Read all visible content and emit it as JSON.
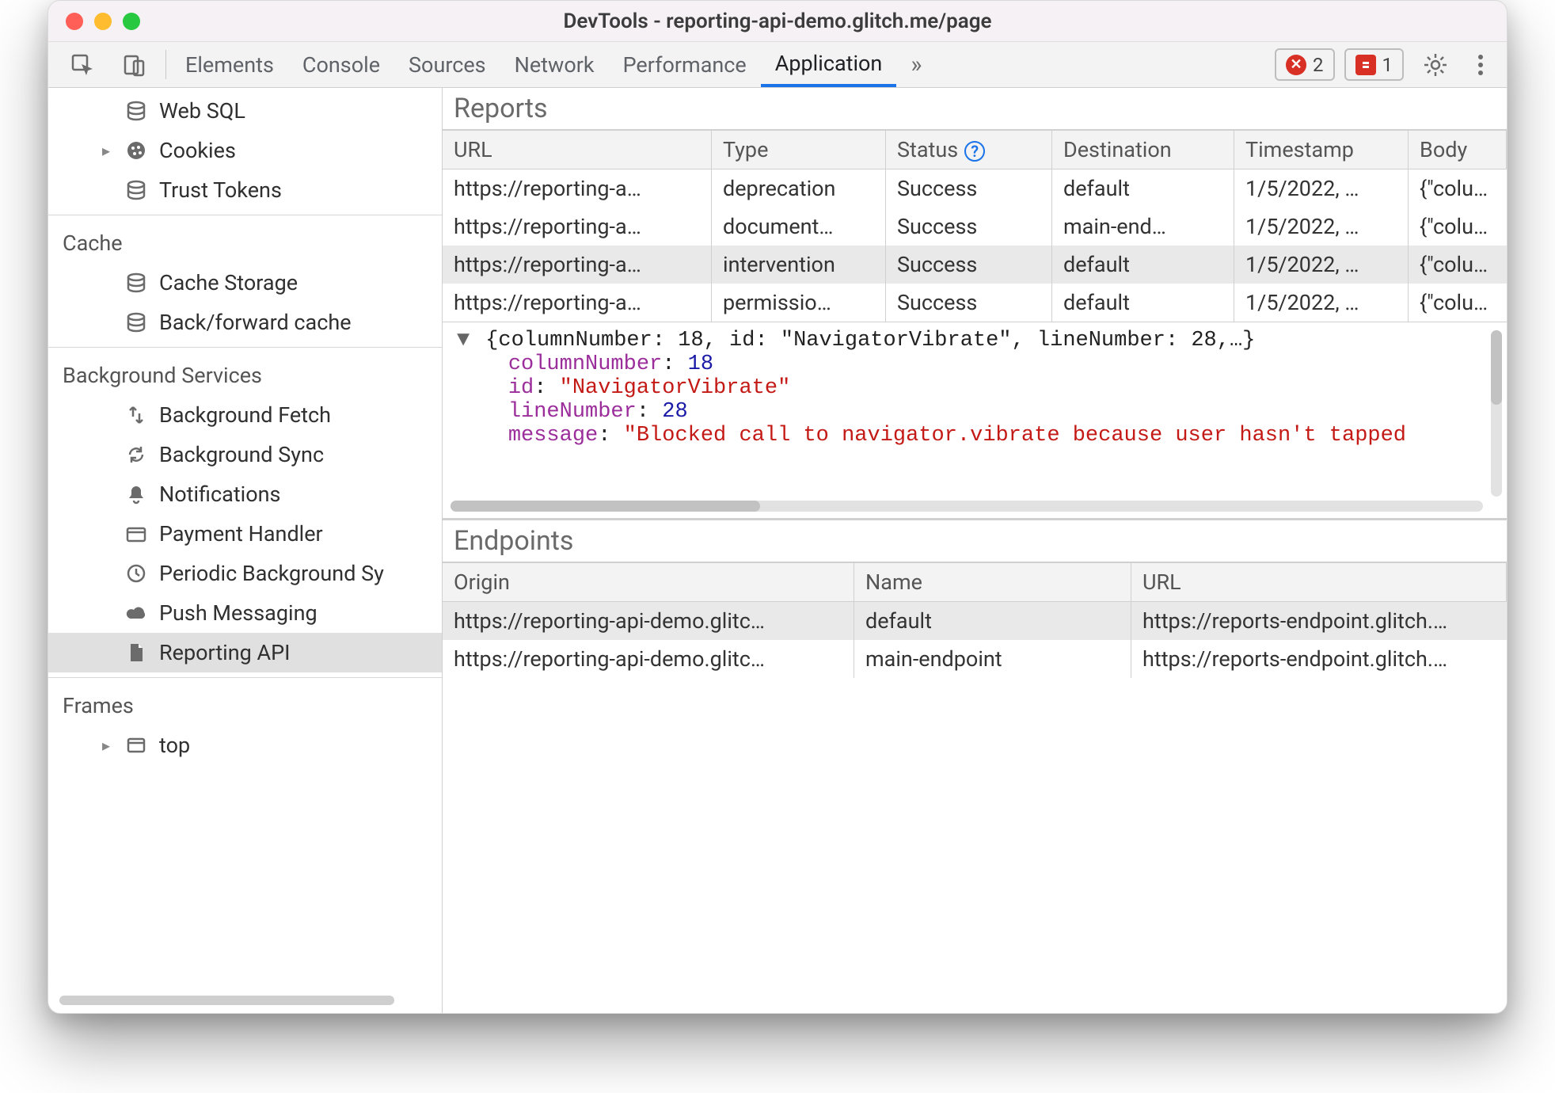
{
  "window": {
    "title": "DevTools - reporting-api-demo.glitch.me/page"
  },
  "tabrow": {
    "tabs": [
      "Elements",
      "Console",
      "Sources",
      "Network",
      "Performance",
      "Application"
    ],
    "active": "Application",
    "errors_count": "2",
    "issues_count": "1"
  },
  "sidebar": {
    "group1": [
      {
        "icon": "db",
        "label": "Web SQL"
      },
      {
        "icon": "cookie",
        "label": "Cookies",
        "caret": true
      },
      {
        "icon": "db",
        "label": "Trust Tokens"
      }
    ],
    "cache_label": "Cache",
    "cache": [
      {
        "icon": "db",
        "label": "Cache Storage"
      },
      {
        "icon": "db",
        "label": "Back/forward cache"
      }
    ],
    "bg_label": "Background Services",
    "bg": [
      {
        "icon": "bgfetch",
        "label": "Background Fetch"
      },
      {
        "icon": "sync",
        "label": "Background Sync"
      },
      {
        "icon": "bell",
        "label": "Notifications"
      },
      {
        "icon": "card",
        "label": "Payment Handler"
      },
      {
        "icon": "clock",
        "label": "Periodic Background Sy"
      },
      {
        "icon": "cloud",
        "label": "Push Messaging"
      },
      {
        "icon": "doc",
        "label": "Reporting API",
        "selected": true
      }
    ],
    "frames_label": "Frames",
    "frames": [
      {
        "icon": "frame",
        "label": "top",
        "caret": true
      }
    ]
  },
  "reports": {
    "title": "Reports",
    "headers": [
      "URL",
      "Type",
      "Status",
      "Destination",
      "Timestamp",
      "Body"
    ],
    "rows": [
      {
        "url": "https://reporting-a…",
        "type": "deprecation",
        "status": "Success",
        "dest": "default",
        "ts": "1/5/2022, …",
        "body": "{\"column…"
      },
      {
        "url": "https://reporting-a…",
        "type": "document…",
        "status": "Success",
        "dest": "main-end…",
        "ts": "1/5/2022, …",
        "body": "{\"column…"
      },
      {
        "url": "https://reporting-a…",
        "type": "intervention",
        "status": "Success",
        "dest": "default",
        "ts": "1/5/2022, …",
        "body": "{\"column…",
        "selected": true
      },
      {
        "url": "https://reporting-a…",
        "type": "permissio…",
        "status": "Success",
        "dest": "default",
        "ts": "1/5/2022, …",
        "body": "{\"column…"
      }
    ]
  },
  "preview": {
    "summary": "{columnNumber: 18, id: \"NavigatorVibrate\", lineNumber: 28,…}",
    "columnNumber_key": "columnNumber",
    "columnNumber_val": "18",
    "id_key": "id",
    "id_val": "\"NavigatorVibrate\"",
    "lineNumber_key": "lineNumber",
    "lineNumber_val": "28",
    "message_key": "message",
    "message_val": "\"Blocked call to navigator.vibrate because user hasn't tapped"
  },
  "endpoints": {
    "title": "Endpoints",
    "headers": [
      "Origin",
      "Name",
      "URL"
    ],
    "rows": [
      {
        "origin": "https://reporting-api-demo.glitc…",
        "name": "default",
        "url": "https://reports-endpoint.glitch.…",
        "selected": true
      },
      {
        "origin": "https://reporting-api-demo.glitc…",
        "name": "main-endpoint",
        "url": "https://reports-endpoint.glitch.…"
      }
    ]
  }
}
